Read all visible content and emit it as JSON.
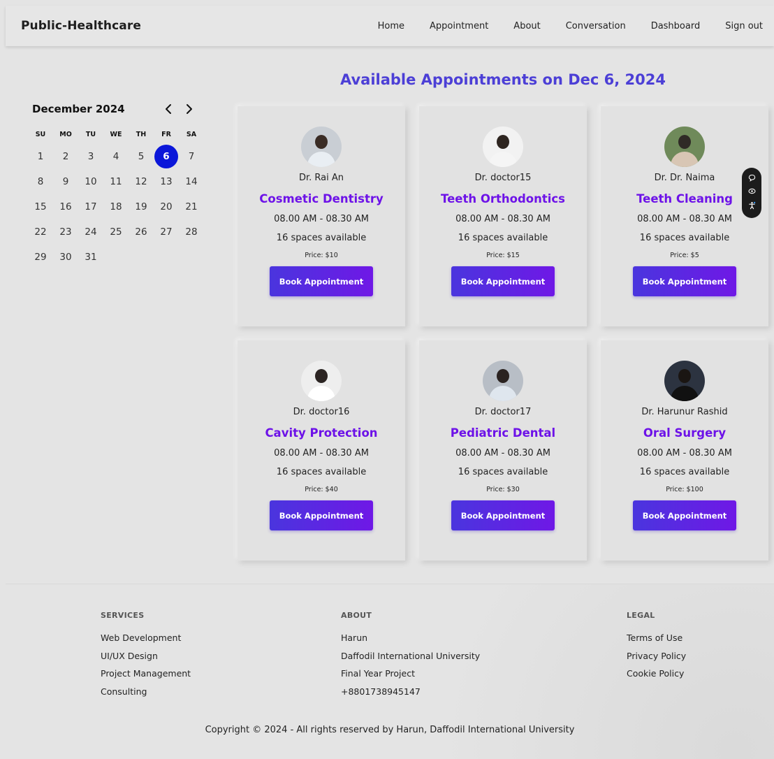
{
  "nav": {
    "brand": "Public-Healthcare",
    "links": [
      "Home",
      "Appointment",
      "About",
      "Conversation",
      "Dashboard",
      "Sign out"
    ]
  },
  "calendar": {
    "title": "December 2024",
    "prev_icon": "chevron-left-icon",
    "next_icon": "chevron-right-icon",
    "weekdays": [
      "SU",
      "MO",
      "TU",
      "WE",
      "TH",
      "FR",
      "SA"
    ],
    "days": [
      "1",
      "2",
      "3",
      "4",
      "5",
      "6",
      "7",
      "8",
      "9",
      "10",
      "11",
      "12",
      "13",
      "14",
      "15",
      "16",
      "17",
      "18",
      "19",
      "20",
      "21",
      "22",
      "23",
      "24",
      "25",
      "26",
      "27",
      "28",
      "29",
      "30",
      "31"
    ],
    "selected_day": "6"
  },
  "main": {
    "title": "Available Appointments on Dec 6, 2024",
    "accent_color": "#4c3fd6",
    "specialty_color": "#6d12e8",
    "cards": [
      {
        "doctor": "Dr. Rai An",
        "specialty": "Cosmetic Dentistry",
        "time": "08.00 AM - 08.30 AM",
        "spaces": "16 spaces available",
        "price": "Price: $10",
        "button": "Book Appointment"
      },
      {
        "doctor": "Dr. doctor15",
        "specialty": "Teeth Orthodontics",
        "time": "08.00 AM - 08.30 AM",
        "spaces": "16 spaces available",
        "price": "Price: $15",
        "button": "Book Appointment"
      },
      {
        "doctor": "Dr. Dr. Naima",
        "specialty": "Teeth Cleaning",
        "time": "08.00 AM - 08.30 AM",
        "spaces": "16 spaces available",
        "price": "Price: $5",
        "button": "Book Appointment"
      },
      {
        "doctor": "Dr. doctor16",
        "specialty": "Cavity Protection",
        "time": "08.00 AM - 08.30 AM",
        "spaces": "16 spaces available",
        "price": "Price: $40",
        "button": "Book Appointment"
      },
      {
        "doctor": "Dr. doctor17",
        "specialty": "Pediatric Dental",
        "time": "08.00 AM - 08.30 AM",
        "spaces": "16 spaces available",
        "price": "Price: $30",
        "button": "Book Appointment"
      },
      {
        "doctor": "Dr. Harunur Rashid",
        "specialty": "Oral Surgery",
        "time": "08.00 AM - 08.30 AM",
        "spaces": "16 spaces available",
        "price": "Price: $100",
        "button": "Book Appointment"
      }
    ]
  },
  "widget": {
    "icons": [
      "chat-icon",
      "eye-icon",
      "accessibility-icon"
    ]
  },
  "footer": {
    "services": {
      "heading": "SERVICES",
      "items": [
        "Web Development",
        "UI/UX Design",
        "Project Management",
        "Consulting"
      ]
    },
    "about": {
      "heading": "ABOUT",
      "items": [
        "Harun",
        "Daffodil International University",
        "Final Year Project",
        "+8801738945147"
      ]
    },
    "legal": {
      "heading": "LEGAL",
      "items": [
        "Terms of Use",
        "Privacy Policy",
        "Cookie Policy"
      ]
    },
    "copyright": "Copyright © 2024 - All rights reserved by Harun, Daffodil International University"
  }
}
